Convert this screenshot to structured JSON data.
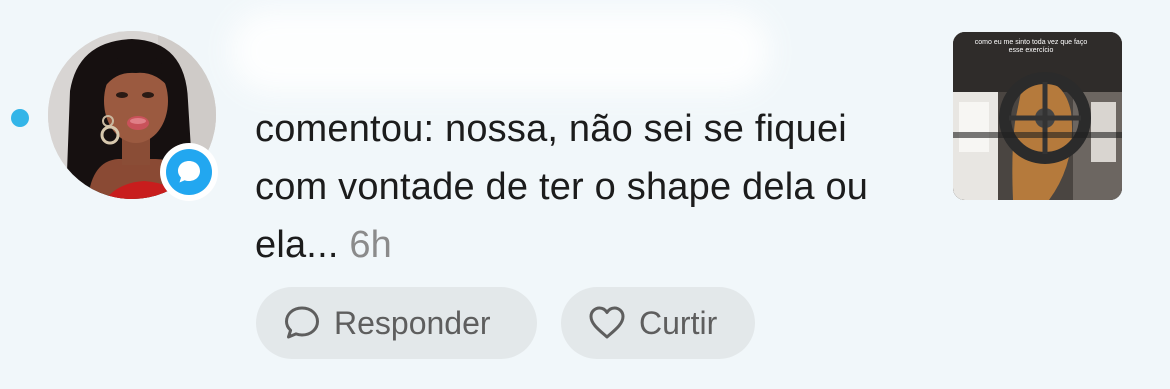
{
  "notification": {
    "comment_text": "comentou: nossa, não sei se fiquei com vontade de ter o shape dela ou ela...",
    "time": "6h",
    "thumbnail_caption": "como eu me sinto toda vez que faço esse exercício"
  },
  "actions": {
    "reply_label": "Responder",
    "like_label": "Curtir"
  },
  "icons": {
    "badge": "comment-bubble-icon",
    "reply": "speech-bubble-icon",
    "like": "heart-icon"
  },
  "colors": {
    "background": "#f1f7fa",
    "accent": "#22a7f0",
    "unread_dot": "#33b5e8",
    "pill_background": "#e3e8ea",
    "muted_text": "#8b8b8b"
  }
}
